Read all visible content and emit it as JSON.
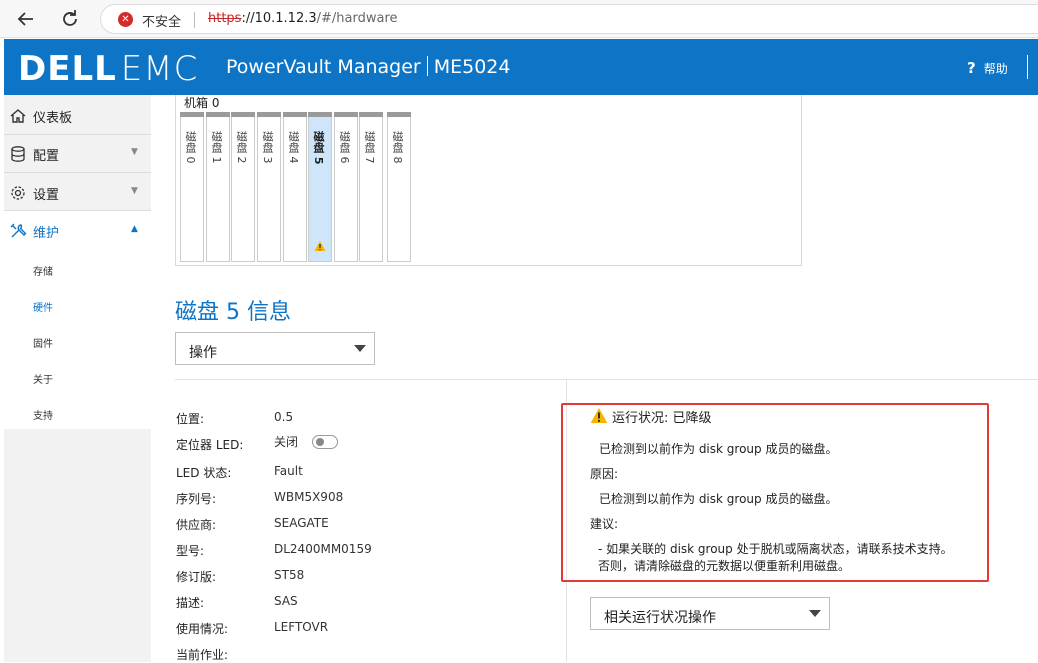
{
  "browser": {
    "security_label": "不安全",
    "url_scheme": "https",
    "url_host": "://10.1.12.3",
    "url_path": "/#/hardware"
  },
  "header": {
    "logo_dell": "DELL",
    "logo_emc": "EMC",
    "product": "PowerVault Manager",
    "model": "ME5024",
    "help_label": "帮助"
  },
  "sidebar": {
    "items": [
      {
        "label": "仪表板"
      },
      {
        "label": "配置"
      },
      {
        "label": "设置"
      },
      {
        "label": "维护"
      }
    ],
    "subitems": [
      {
        "label": "存储"
      },
      {
        "label": "硬件"
      },
      {
        "label": "固件"
      },
      {
        "label": "关于"
      },
      {
        "label": "支持"
      }
    ]
  },
  "enclosure": {
    "title": "机箱 0",
    "slots": [
      "磁盘 0",
      "磁盘 1",
      "磁盘 2",
      "磁盘 3",
      "磁盘 4",
      "磁盘 5",
      "磁盘 6",
      "磁盘 7",
      "磁盘 8"
    ],
    "selected_slot": 5
  },
  "disk": {
    "title": "磁盘 5 信息",
    "action_select": "操作",
    "properties": [
      {
        "key": "位置:",
        "value": "0.5"
      },
      {
        "key": "定位器 LED:",
        "value": "关闭"
      },
      {
        "key": "LED 状态:",
        "value": "Fault"
      },
      {
        "key": "序列号:",
        "value": "WBM5X908"
      },
      {
        "key": "供应商:",
        "value": "SEAGATE"
      },
      {
        "key": "型号:",
        "value": "DL2400MM0159"
      },
      {
        "key": "修订版:",
        "value": "ST58"
      },
      {
        "key": "描述:",
        "value": "SAS"
      },
      {
        "key": "使用情况:",
        "value": "LEFTOVR"
      },
      {
        "key": "当前作业:",
        "value": ""
      }
    ]
  },
  "health": {
    "status": "运行状况: 已降级",
    "status_desc": "已检测到以前作为 disk group 成员的磁盘。",
    "reason_label": "原因:",
    "reason": "已检测到以前作为 disk group 成员的磁盘。",
    "recommend_label": "建议:",
    "recommend_line1": "- 如果关联的 disk group 处于脱机或隔离状态，请联系技术支持。",
    "recommend_line2": "否则，请清除磁盘的元数据以便重新利用磁盘。",
    "action_select": "相关运行状况操作"
  },
  "colors": {
    "brand": "#0d74c6",
    "highlight_border": "#e53935",
    "warning": "#f5b400"
  },
  "icons": {
    "dashboard": "home-icon",
    "config": "database-icon",
    "settings": "gear-icon",
    "maintenance": "tools-icon",
    "warning": "warning-triangle-icon"
  }
}
